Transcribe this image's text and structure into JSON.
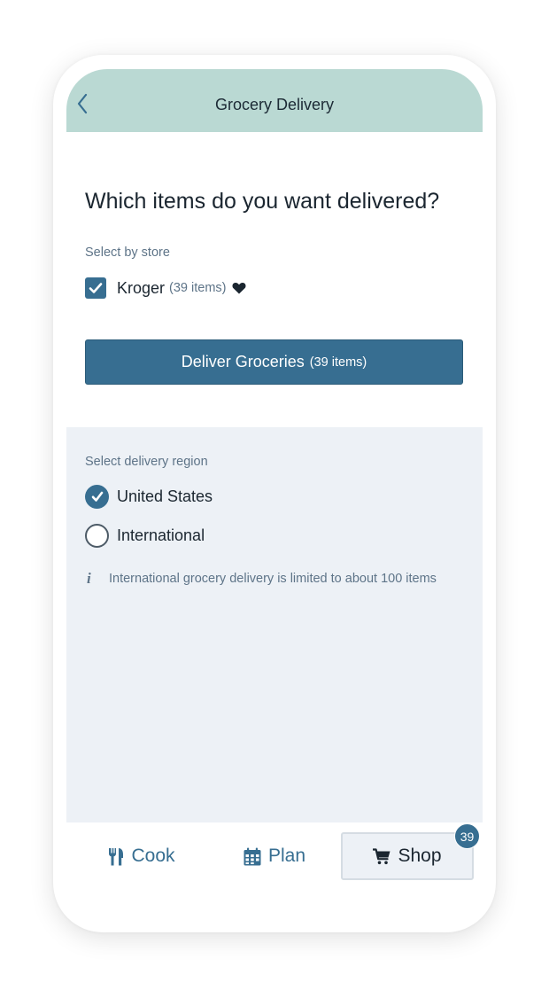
{
  "header": {
    "title": "Grocery Delivery",
    "back_icon": "chevron-left-icon"
  },
  "main": {
    "question": "Which items do you want delivered?",
    "store_section_label": "Select by store",
    "stores": [
      {
        "name": "Kroger",
        "count": "(39 items)",
        "checked": true,
        "favorite": true
      }
    ],
    "deliver_button": {
      "label": "Deliver Groceries",
      "count": "(39 items)"
    }
  },
  "region": {
    "label": "Select delivery region",
    "options": [
      {
        "label": "United States",
        "selected": true
      },
      {
        "label": "International",
        "selected": false
      }
    ],
    "info_icon": "i",
    "info_text": "International grocery delivery is limited to about 100 items"
  },
  "tabs": [
    {
      "label": "Cook",
      "icon": "utensils-icon",
      "active": false
    },
    {
      "label": "Plan",
      "icon": "calendar-icon",
      "active": false
    },
    {
      "label": "Shop",
      "icon": "cart-icon",
      "active": true,
      "badge": "39"
    }
  ],
  "colors": {
    "header_bg": "#bad9d3",
    "accent": "#376e91",
    "region_bg": "#edf1f6",
    "text_dark": "#1b2630",
    "text_muted": "#5e7488"
  }
}
